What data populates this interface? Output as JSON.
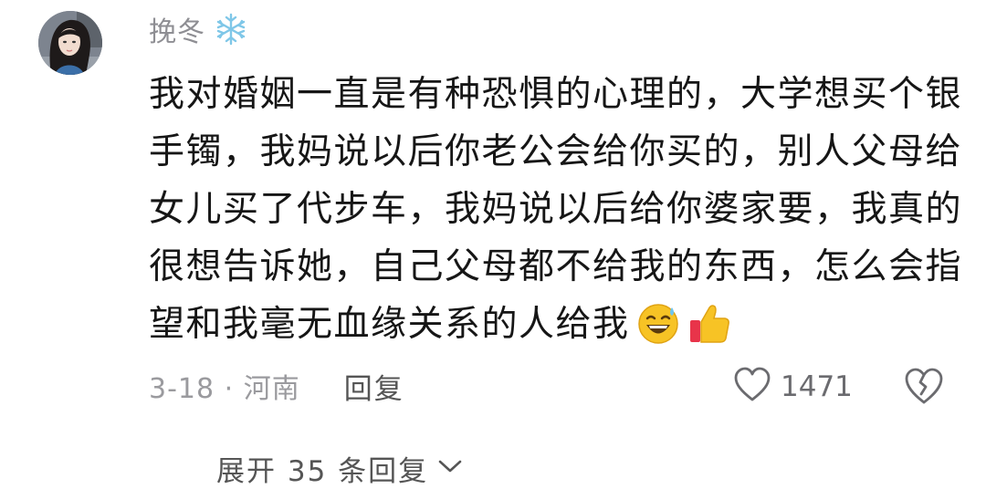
{
  "comment": {
    "username": "挽冬",
    "username_badge_icon": "snowflake-icon",
    "text_lines": [
      "我对婚姻一直是有种恐惧的心理的，大学想买个银",
      "手镯，我妈说以后你老公会给你买的，别人父母给",
      "女儿买了代步车，我妈说以后给你婆家要，我真的",
      "很想告诉她，自己父母都不给我的东西，怎么会指",
      "望和我毫无血缘关系的人给我"
    ],
    "trailing_emojis": [
      "grinning-sweat-emoji",
      "thumbs-up-emoji"
    ],
    "date_location": "3-18 · 河南",
    "reply_label": "回复",
    "like_count": "1471",
    "expand_replies_label": "展开 35 条回复"
  },
  "colors": {
    "text_primary": "#161616",
    "text_secondary": "#9a9a9e",
    "icon_gray": "#6b6b6f",
    "emoji_yellow": "#f7c325",
    "thumb_red": "#e8344a"
  }
}
